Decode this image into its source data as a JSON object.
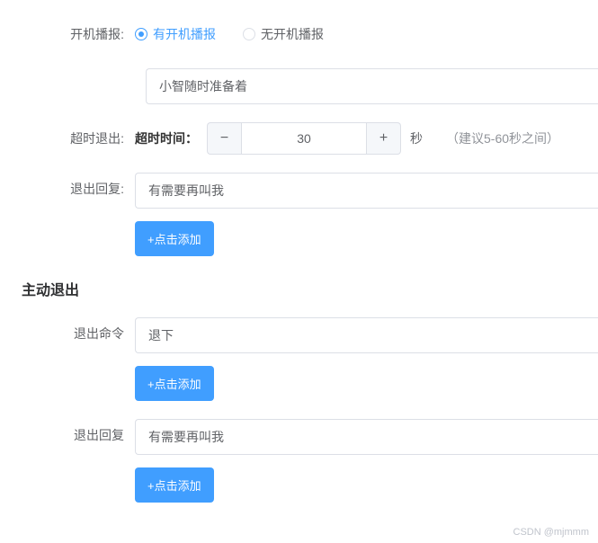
{
  "boot_broadcast": {
    "label": "开机播报:",
    "options": {
      "with": "有开机播报",
      "without": "无开机播报"
    },
    "message_value": "小智随时准备着"
  },
  "timeout_exit": {
    "label": "超时退出:",
    "time_label": "超时时间：",
    "value": "30",
    "unit": "秒",
    "hint": "（建议5-60秒之间）"
  },
  "exit_reply": {
    "label": "退出回复:",
    "value": "有需要再叫我",
    "add_button": "+点击添加"
  },
  "active_exit": {
    "title": "主动退出",
    "command_label": "退出命令",
    "command_value": "退下",
    "reply_label": "退出回复",
    "reply_value": "有需要再叫我",
    "add_button": "+点击添加"
  },
  "watermark": "CSDN @mjmmm"
}
